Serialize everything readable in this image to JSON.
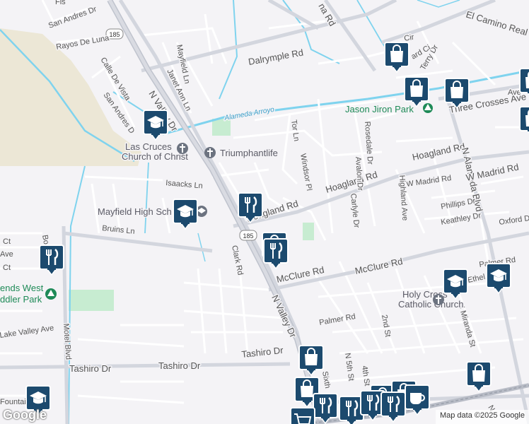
{
  "roads": {
    "n_valley_dr": "N Valley Dr",
    "n_valley_dr_2": "N Valley Dr",
    "route_185": "185",
    "dalrymple_rd": "Dalrymple Rd",
    "hoagland_rd_east": "Hoagland Rd",
    "hoagland_rd": "Hoagland Rd",
    "hoagland_rd_west": "Hoagland Rd",
    "mcclure_rd": "McClure Rd",
    "mcclure_rd_west": "McClure Rd",
    "tashiro_dr": "Tashiro Dr",
    "tashiro_dr_mid": "Tashiro Dr",
    "tashiro_dr_east": "Tashiro Dr",
    "isaacks_ln": "Isaacks Ln",
    "bruins_ln": "Bruins Ln",
    "clark_rd": "Clark Rd",
    "motel_blvd": "Motel Blvd",
    "lake_valley_ave": "Lake Valley Ave",
    "n_alameda_blvd": "N Alameda Blvd",
    "el_camino_real": "El Camino Real R",
    "three_crosses_ave": "Three Crosses Ave",
    "w_madrid_rd": "W Madrid Rd",
    "w_madrid_rd_small": "W Madrid Rd",
    "phillips_dr": "Phillips Dr",
    "keathley_dr": "Keathley Dr",
    "oxford_dr": "Oxford Dr",
    "palmer_rd": "Palmer Rd",
    "palmer_rd_east": "Palmer Rd",
    "highland_ave": "Highland Ave",
    "n_miranda_st": "N Miranda St",
    "tor_ln": "Tor Ln",
    "windsor_pl": "Windsor Pl",
    "avalon_dr": "Avalon Dr",
    "rosedale_dr": "Rosedale Dr",
    "carlyle_dr": "Carlyle Dr",
    "second_st": "2nd St",
    "n_fifth_st": "N 5th St",
    "fourth_st": "4th St",
    "sixth": "Sixth",
    "mayfield_ln": "Mayfield Ln",
    "janet_ann_ln": "Janet Ann Ln",
    "rayos_de_luna": "Rayos De Luna",
    "san_andres_dr": "San Andres Dr",
    "san_andres_dr_2": "San Andres D",
    "calle_de_vista": "Calle De Vista",
    "terry_dr": "Terry Dr",
    "ethel": "Ethel",
    "el_paseo_rd_frag": "ard Ci",
    "ct_frag_1": "Ct",
    "ct_frag_2": "Ct",
    "ave_frag": "Ave",
    "fountain_frag": "Fountai",
    "bo_frag": "Bo",
    "na_rd_frag": "na Rd",
    "cir_frag": "Cir",
    "fis_frag": "Fis",
    "ave_east_frag": "Ave",
    "n_frag": "N"
  },
  "water": {
    "alameda_arroyo": "Alameda Arroyo"
  },
  "places": {
    "jason_jiron_park": "Jason Jiron Park",
    "las_cruces_church_line1": "Las Cruces",
    "las_cruces_church_line2": "Church of Christ",
    "triumphantlife": "Triumphantlife",
    "mayfield_high": "Mayfield High Sch",
    "holy_cross_line1": "Holy Cross",
    "holy_cross_line2": "Catholic Church",
    "west_park_line1": "ends West",
    "west_park_line2": "ddler Park"
  },
  "attribution": {
    "google": "Google",
    "map_data": "Map data ©2025 Google"
  },
  "colors": {
    "pin_fill": "#1c4a6e",
    "water": "#7fd3ee",
    "park": "#c7ecd1",
    "major_road": "#c4c8d2",
    "desert": "#ece7d6"
  }
}
